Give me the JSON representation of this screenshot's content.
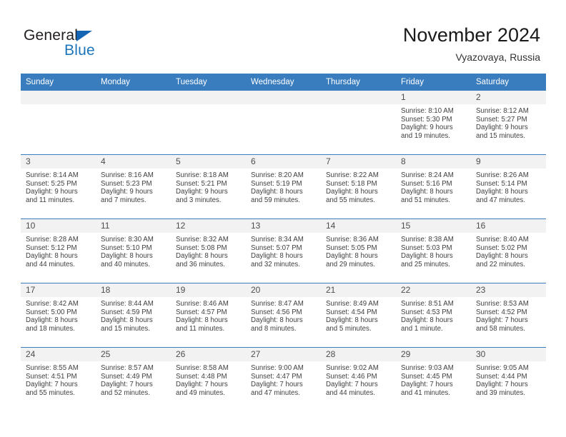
{
  "logo": {
    "word_one": "General",
    "word_two": "Blue",
    "triangle_color": "#1565b5",
    "blue_color": "#1b75bb"
  },
  "header": {
    "month_title": "November 2024",
    "location": "Vyazovaya, Russia"
  },
  "theme": {
    "header_blue": "#3a7dbf",
    "daynum_band": "#f2f2f2",
    "text": "#404040"
  },
  "weekday_headers": [
    "Sunday",
    "Monday",
    "Tuesday",
    "Wednesday",
    "Thursday",
    "Friday",
    "Saturday"
  ],
  "weeks": [
    [
      {
        "day": "",
        "sunrise": "",
        "sunset": "",
        "daylight_line1": "",
        "daylight_line2": ""
      },
      {
        "day": "",
        "sunrise": "",
        "sunset": "",
        "daylight_line1": "",
        "daylight_line2": ""
      },
      {
        "day": "",
        "sunrise": "",
        "sunset": "",
        "daylight_line1": "",
        "daylight_line2": ""
      },
      {
        "day": "",
        "sunrise": "",
        "sunset": "",
        "daylight_line1": "",
        "daylight_line2": ""
      },
      {
        "day": "",
        "sunrise": "",
        "sunset": "",
        "daylight_line1": "",
        "daylight_line2": ""
      },
      {
        "day": "1",
        "sunrise": "Sunrise: 8:10 AM",
        "sunset": "Sunset: 5:30 PM",
        "daylight_line1": "Daylight: 9 hours",
        "daylight_line2": "and 19 minutes."
      },
      {
        "day": "2",
        "sunrise": "Sunrise: 8:12 AM",
        "sunset": "Sunset: 5:27 PM",
        "daylight_line1": "Daylight: 9 hours",
        "daylight_line2": "and 15 minutes."
      }
    ],
    [
      {
        "day": "3",
        "sunrise": "Sunrise: 8:14 AM",
        "sunset": "Sunset: 5:25 PM",
        "daylight_line1": "Daylight: 9 hours",
        "daylight_line2": "and 11 minutes."
      },
      {
        "day": "4",
        "sunrise": "Sunrise: 8:16 AM",
        "sunset": "Sunset: 5:23 PM",
        "daylight_line1": "Daylight: 9 hours",
        "daylight_line2": "and 7 minutes."
      },
      {
        "day": "5",
        "sunrise": "Sunrise: 8:18 AM",
        "sunset": "Sunset: 5:21 PM",
        "daylight_line1": "Daylight: 9 hours",
        "daylight_line2": "and 3 minutes."
      },
      {
        "day": "6",
        "sunrise": "Sunrise: 8:20 AM",
        "sunset": "Sunset: 5:19 PM",
        "daylight_line1": "Daylight: 8 hours",
        "daylight_line2": "and 59 minutes."
      },
      {
        "day": "7",
        "sunrise": "Sunrise: 8:22 AM",
        "sunset": "Sunset: 5:18 PM",
        "daylight_line1": "Daylight: 8 hours",
        "daylight_line2": "and 55 minutes."
      },
      {
        "day": "8",
        "sunrise": "Sunrise: 8:24 AM",
        "sunset": "Sunset: 5:16 PM",
        "daylight_line1": "Daylight: 8 hours",
        "daylight_line2": "and 51 minutes."
      },
      {
        "day": "9",
        "sunrise": "Sunrise: 8:26 AM",
        "sunset": "Sunset: 5:14 PM",
        "daylight_line1": "Daylight: 8 hours",
        "daylight_line2": "and 47 minutes."
      }
    ],
    [
      {
        "day": "10",
        "sunrise": "Sunrise: 8:28 AM",
        "sunset": "Sunset: 5:12 PM",
        "daylight_line1": "Daylight: 8 hours",
        "daylight_line2": "and 44 minutes."
      },
      {
        "day": "11",
        "sunrise": "Sunrise: 8:30 AM",
        "sunset": "Sunset: 5:10 PM",
        "daylight_line1": "Daylight: 8 hours",
        "daylight_line2": "and 40 minutes."
      },
      {
        "day": "12",
        "sunrise": "Sunrise: 8:32 AM",
        "sunset": "Sunset: 5:08 PM",
        "daylight_line1": "Daylight: 8 hours",
        "daylight_line2": "and 36 minutes."
      },
      {
        "day": "13",
        "sunrise": "Sunrise: 8:34 AM",
        "sunset": "Sunset: 5:07 PM",
        "daylight_line1": "Daylight: 8 hours",
        "daylight_line2": "and 32 minutes."
      },
      {
        "day": "14",
        "sunrise": "Sunrise: 8:36 AM",
        "sunset": "Sunset: 5:05 PM",
        "daylight_line1": "Daylight: 8 hours",
        "daylight_line2": "and 29 minutes."
      },
      {
        "day": "15",
        "sunrise": "Sunrise: 8:38 AM",
        "sunset": "Sunset: 5:03 PM",
        "daylight_line1": "Daylight: 8 hours",
        "daylight_line2": "and 25 minutes."
      },
      {
        "day": "16",
        "sunrise": "Sunrise: 8:40 AM",
        "sunset": "Sunset: 5:02 PM",
        "daylight_line1": "Daylight: 8 hours",
        "daylight_line2": "and 22 minutes."
      }
    ],
    [
      {
        "day": "17",
        "sunrise": "Sunrise: 8:42 AM",
        "sunset": "Sunset: 5:00 PM",
        "daylight_line1": "Daylight: 8 hours",
        "daylight_line2": "and 18 minutes."
      },
      {
        "day": "18",
        "sunrise": "Sunrise: 8:44 AM",
        "sunset": "Sunset: 4:59 PM",
        "daylight_line1": "Daylight: 8 hours",
        "daylight_line2": "and 15 minutes."
      },
      {
        "day": "19",
        "sunrise": "Sunrise: 8:46 AM",
        "sunset": "Sunset: 4:57 PM",
        "daylight_line1": "Daylight: 8 hours",
        "daylight_line2": "and 11 minutes."
      },
      {
        "day": "20",
        "sunrise": "Sunrise: 8:47 AM",
        "sunset": "Sunset: 4:56 PM",
        "daylight_line1": "Daylight: 8 hours",
        "daylight_line2": "and 8 minutes."
      },
      {
        "day": "21",
        "sunrise": "Sunrise: 8:49 AM",
        "sunset": "Sunset: 4:54 PM",
        "daylight_line1": "Daylight: 8 hours",
        "daylight_line2": "and 5 minutes."
      },
      {
        "day": "22",
        "sunrise": "Sunrise: 8:51 AM",
        "sunset": "Sunset: 4:53 PM",
        "daylight_line1": "Daylight: 8 hours",
        "daylight_line2": "and 1 minute."
      },
      {
        "day": "23",
        "sunrise": "Sunrise: 8:53 AM",
        "sunset": "Sunset: 4:52 PM",
        "daylight_line1": "Daylight: 7 hours",
        "daylight_line2": "and 58 minutes."
      }
    ],
    [
      {
        "day": "24",
        "sunrise": "Sunrise: 8:55 AM",
        "sunset": "Sunset: 4:51 PM",
        "daylight_line1": "Daylight: 7 hours",
        "daylight_line2": "and 55 minutes."
      },
      {
        "day": "25",
        "sunrise": "Sunrise: 8:57 AM",
        "sunset": "Sunset: 4:49 PM",
        "daylight_line1": "Daylight: 7 hours",
        "daylight_line2": "and 52 minutes."
      },
      {
        "day": "26",
        "sunrise": "Sunrise: 8:58 AM",
        "sunset": "Sunset: 4:48 PM",
        "daylight_line1": "Daylight: 7 hours",
        "daylight_line2": "and 49 minutes."
      },
      {
        "day": "27",
        "sunrise": "Sunrise: 9:00 AM",
        "sunset": "Sunset: 4:47 PM",
        "daylight_line1": "Daylight: 7 hours",
        "daylight_line2": "and 47 minutes."
      },
      {
        "day": "28",
        "sunrise": "Sunrise: 9:02 AM",
        "sunset": "Sunset: 4:46 PM",
        "daylight_line1": "Daylight: 7 hours",
        "daylight_line2": "and 44 minutes."
      },
      {
        "day": "29",
        "sunrise": "Sunrise: 9:03 AM",
        "sunset": "Sunset: 4:45 PM",
        "daylight_line1": "Daylight: 7 hours",
        "daylight_line2": "and 41 minutes."
      },
      {
        "day": "30",
        "sunrise": "Sunrise: 9:05 AM",
        "sunset": "Sunset: 4:44 PM",
        "daylight_line1": "Daylight: 7 hours",
        "daylight_line2": "and 39 minutes."
      }
    ]
  ]
}
